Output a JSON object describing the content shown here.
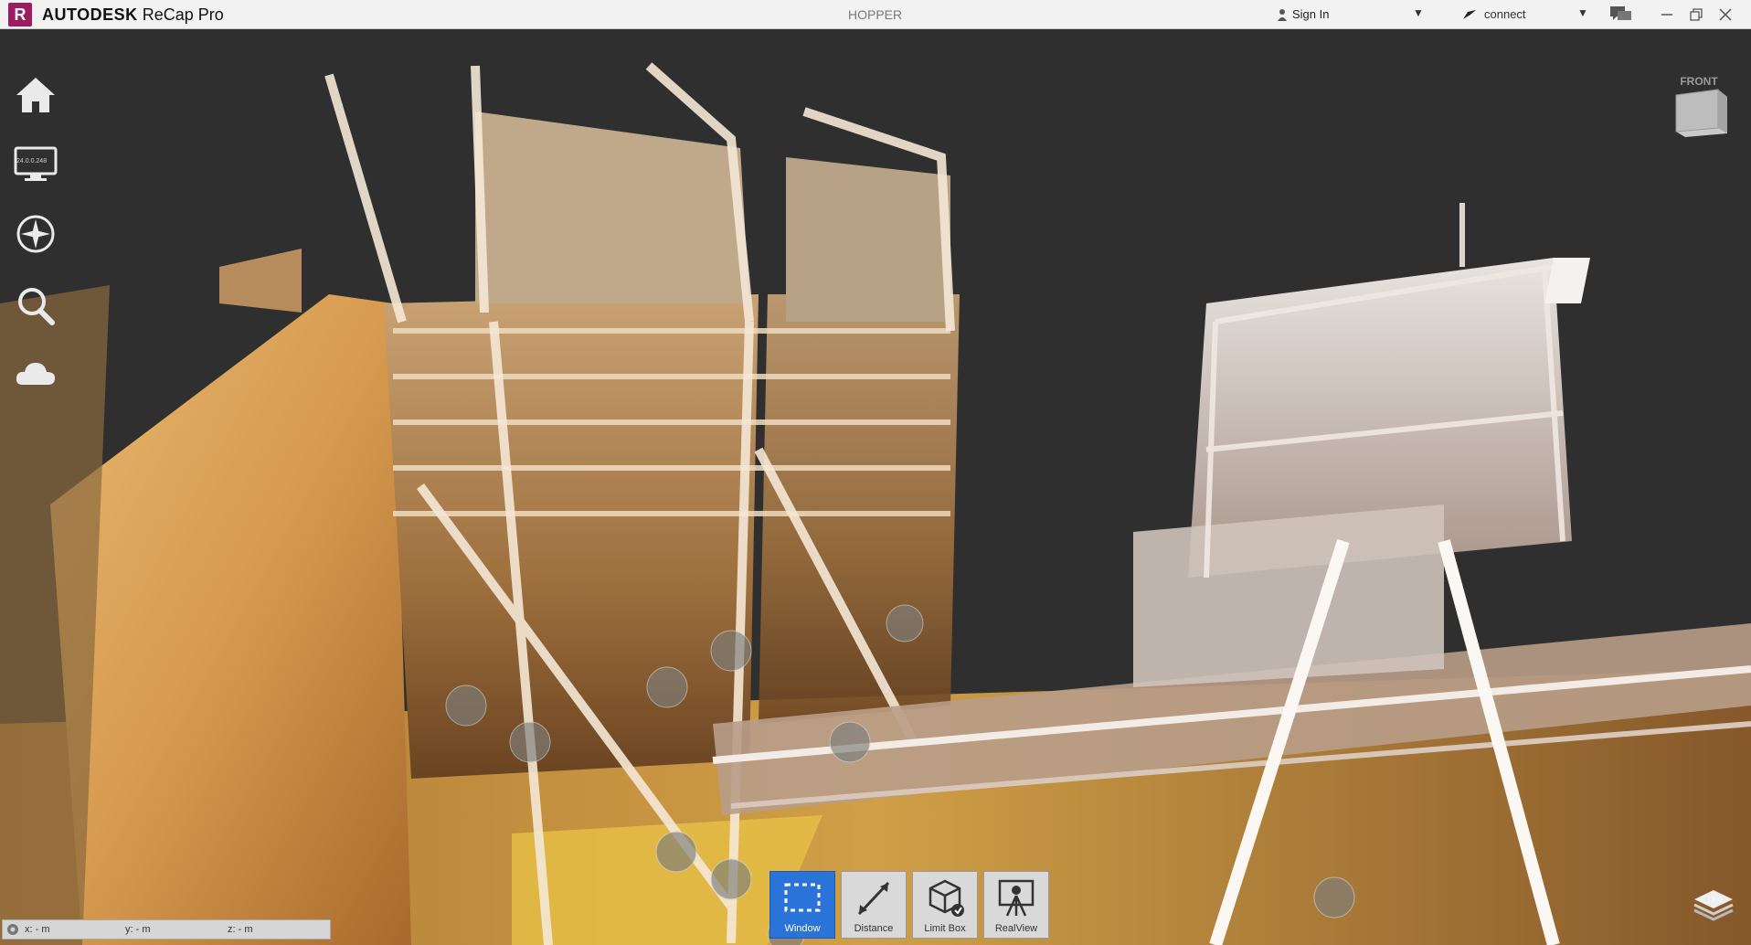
{
  "titlebar": {
    "logo_letter": "R",
    "brand": "AUTODESK",
    "product": "ReCap Pro",
    "project_name": "HOPPER",
    "signin_label": "Sign In",
    "connect_label": "connect"
  },
  "left_toolbar": {
    "items": [
      {
        "name": "home",
        "icon": "home-icon"
      },
      {
        "name": "display",
        "icon": "monitor-icon",
        "label": "24.0.0.248"
      },
      {
        "name": "navigation",
        "icon": "compass-icon"
      },
      {
        "name": "search",
        "icon": "magnifier-icon"
      },
      {
        "name": "cloud",
        "icon": "cloud-icon"
      }
    ]
  },
  "viewcube": {
    "face": "FRONT"
  },
  "bottom_toolbar": {
    "items": [
      {
        "label": "Window",
        "icon": "window-select-icon",
        "active": true
      },
      {
        "label": "Distance",
        "icon": "distance-icon",
        "active": false
      },
      {
        "label": "Limit Box",
        "icon": "limit-box-icon",
        "active": false
      },
      {
        "label": "RealView",
        "icon": "realview-icon",
        "active": false
      }
    ]
  },
  "status": {
    "x": "x:  - m",
    "y": "y:  - m",
    "z": "z:  - m"
  },
  "colors": {
    "active_blue": "#2a73d9",
    "background": "#2f2f2f",
    "logo": "#9c1b61"
  }
}
